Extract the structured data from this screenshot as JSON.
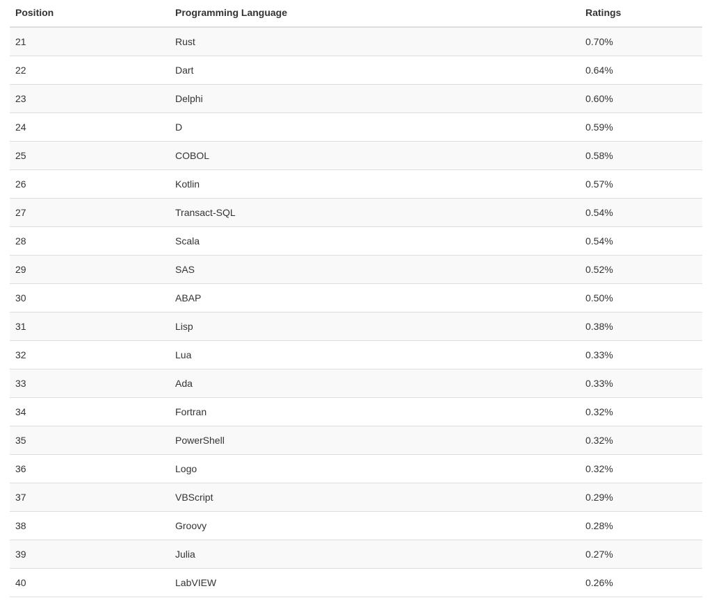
{
  "table": {
    "headers": {
      "position": "Position",
      "language": "Programming Language",
      "ratings": "Ratings"
    },
    "rows": [
      {
        "position": "21",
        "language": "Rust",
        "ratings": "0.70%"
      },
      {
        "position": "22",
        "language": "Dart",
        "ratings": "0.64%"
      },
      {
        "position": "23",
        "language": "Delphi",
        "ratings": "0.60%"
      },
      {
        "position": "24",
        "language": "D",
        "ratings": "0.59%"
      },
      {
        "position": "25",
        "language": "COBOL",
        "ratings": "0.58%"
      },
      {
        "position": "26",
        "language": "Kotlin",
        "ratings": "0.57%"
      },
      {
        "position": "27",
        "language": "Transact-SQL",
        "ratings": "0.54%"
      },
      {
        "position": "28",
        "language": "Scala",
        "ratings": "0.54%"
      },
      {
        "position": "29",
        "language": "SAS",
        "ratings": "0.52%"
      },
      {
        "position": "30",
        "language": "ABAP",
        "ratings": "0.50%"
      },
      {
        "position": "31",
        "language": "Lisp",
        "ratings": "0.38%"
      },
      {
        "position": "32",
        "language": "Lua",
        "ratings": "0.33%"
      },
      {
        "position": "33",
        "language": "Ada",
        "ratings": "0.33%"
      },
      {
        "position": "34",
        "language": "Fortran",
        "ratings": "0.32%"
      },
      {
        "position": "35",
        "language": "PowerShell",
        "ratings": "0.32%"
      },
      {
        "position": "36",
        "language": "Logo",
        "ratings": "0.32%"
      },
      {
        "position": "37",
        "language": "VBScript",
        "ratings": "0.29%"
      },
      {
        "position": "38",
        "language": "Groovy",
        "ratings": "0.28%"
      },
      {
        "position": "39",
        "language": "Julia",
        "ratings": "0.27%"
      },
      {
        "position": "40",
        "language": "LabVIEW",
        "ratings": "0.26%"
      }
    ]
  }
}
